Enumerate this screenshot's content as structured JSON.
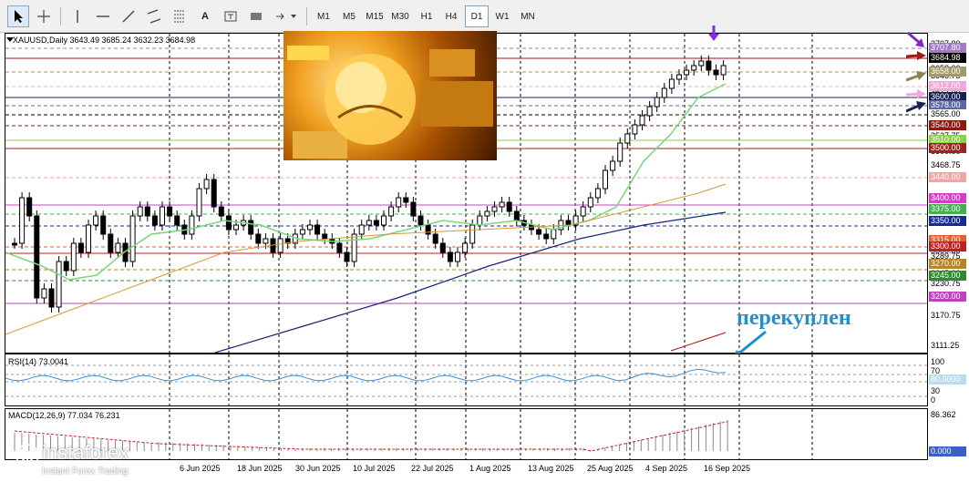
{
  "toolbar": {
    "timeframes": [
      "M1",
      "M5",
      "M15",
      "M30",
      "H1",
      "H4",
      "D1",
      "W1",
      "MN"
    ],
    "active_timeframe": "D1",
    "text_tool": "A"
  },
  "main": {
    "title": "XAUUSD,Daily  3643.49 3685.24 3632.23 3684.98",
    "overlay_text": "перекуплен",
    "price_scale": [
      "3707.80",
      "3684.98",
      "3646.75",
      "3658.00",
      "3612.00",
      "3600.00",
      "3578.00",
      "3565.00",
      "3540.00",
      "3527.75",
      "3510.00",
      "3500.00",
      "3468.75",
      "3440.00",
      "3409.75",
      "3400.00",
      "3375.00",
      "3350.00",
      "3315.00",
      "3300.00",
      "3289.75",
      "3270.00",
      "3245.00",
      "3230.75",
      "3200.00",
      "3170.75",
      "3111.25"
    ],
    "level_tags": [
      {
        "value": "3707.80",
        "bg": "#9e7ac7",
        "fg": "#ffffff"
      },
      {
        "value": "3684.98",
        "bg": "#000000",
        "fg": "#ffffff"
      },
      {
        "value": "3658.00",
        "bg": "#a49a66",
        "fg": "#ffffff"
      },
      {
        "value": "3612.00",
        "bg": "#f4a6d8",
        "fg": "#ffffff"
      },
      {
        "value": "3600.00",
        "bg": "#1a2150",
        "fg": "#ffffff"
      },
      {
        "value": "3578.00",
        "bg": "#5b67a8",
        "fg": "#ffffff"
      },
      {
        "value": "3565.00",
        "bg": "#ffffff",
        "fg": "#000000"
      },
      {
        "value": "3540.00",
        "bg": "#8c1a0e",
        "fg": "#ffffff"
      },
      {
        "value": "3510.00",
        "bg": "#8bcf4a",
        "fg": "#ffffff"
      },
      {
        "value": "3500.00",
        "bg": "#a0221e",
        "fg": "#ffffff"
      },
      {
        "value": "3440.00",
        "bg": "#f2a4a4",
        "fg": "#ffffff"
      },
      {
        "value": "3400.00",
        "bg": "#d63cc8",
        "fg": "#ffffff"
      },
      {
        "value": "3375.00",
        "bg": "#44b04e",
        "fg": "#ffffff"
      },
      {
        "value": "3350.00",
        "bg": "#142a9c",
        "fg": "#ffffff"
      },
      {
        "value": "3315.00",
        "bg": "#e86028",
        "fg": "#ffffff"
      },
      {
        "value": "3300.00",
        "bg": "#c41e1e",
        "fg": "#ffffff"
      },
      {
        "value": "3270.00",
        "bg": "#b28826",
        "fg": "#ffffff"
      },
      {
        "value": "3245.00",
        "bg": "#2e8a2e",
        "fg": "#ffffff"
      },
      {
        "value": "3200.00",
        "bg": "#c040c0",
        "fg": "#ffffff"
      }
    ],
    "dates": [
      "6 Jun 2025",
      "18 Jun 2025",
      "30 Jun 2025",
      "10 Jul 2025",
      "22 Jul 2025",
      "1 Aug 2025",
      "13 Aug 2025",
      "25 Aug 2025",
      "4 Sep 2025",
      "16 Sep 2025"
    ]
  },
  "rsi": {
    "title": "RSI(14) 73.0041",
    "scale": [
      "100",
      "70",
      "30",
      "0"
    ],
    "tag": "80.0000"
  },
  "macd": {
    "title": "MACD(12,26,9) 77.034 76.231",
    "scale_top": "86.362",
    "tag": "0.000"
  },
  "logo": {
    "name": "instaforex",
    "tagline": "Instant Forex Trading"
  },
  "colors": {
    "up": "#ffffff",
    "down": "#000000",
    "ma_fast": "#7ad67a",
    "ma_mid": "#d49a3a",
    "ma_slow": "#1a237e",
    "rsi_line": "#3a8fd8",
    "annotation": "#1e8fd0"
  }
}
